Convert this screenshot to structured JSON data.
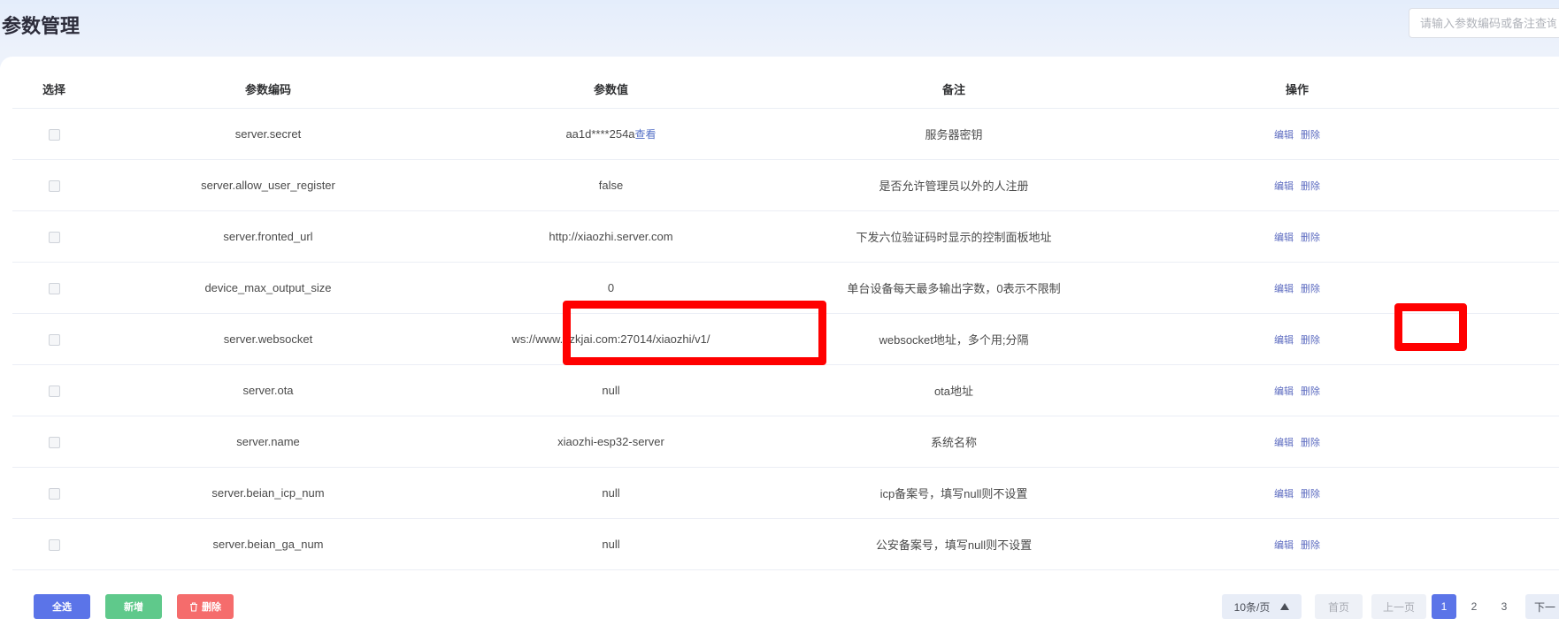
{
  "header": {
    "title": "参数管理",
    "search_placeholder": "请输入参数编码或备注查询"
  },
  "table": {
    "columns": [
      "选择",
      "参数编码",
      "参数值",
      "备注",
      "操作"
    ],
    "rows": [
      {
        "code": "server.secret",
        "value": "aa1d****254a",
        "value_link": "查看",
        "note": "服务器密钥"
      },
      {
        "code": "server.allow_user_register",
        "value": "false",
        "note": "是否允许管理员以外的人注册"
      },
      {
        "code": "server.fronted_url",
        "value": "http://xiaozhi.server.com",
        "note": "下发六位验证码时显示的控制面板地址"
      },
      {
        "code": "device_max_output_size",
        "value": "0",
        "note": "单台设备每天最多输出字数，0表示不限制"
      },
      {
        "code": "server.websocket",
        "value": "ws://www.hzkjai.com:27014/xiaozhi/v1/",
        "note": "websocket地址，多个用;分隔"
      },
      {
        "code": "server.ota",
        "value": "null",
        "note": "ota地址"
      },
      {
        "code": "server.name",
        "value": "xiaozhi-esp32-server",
        "note": "系统名称"
      },
      {
        "code": "server.beian_icp_num",
        "value": "null",
        "note": "icp备案号，填写null则不设置"
      },
      {
        "code": "server.beian_ga_num",
        "value": "null",
        "note": "公安备案号，填写null则不设置"
      }
    ],
    "actions": {
      "edit": "编辑",
      "delete": "删除"
    }
  },
  "footer": {
    "select_all": "全选",
    "add": "新增",
    "delete": "删除",
    "page_size": "10条/页",
    "first": "首页",
    "prev": "上一页",
    "pages": [
      "1",
      "2",
      "3"
    ],
    "next": "下一"
  },
  "colors": {
    "select_all_btn": "#5b74e8",
    "add_btn": "#5fc98b",
    "delete_btn": "#f56c6c",
    "highlight": "#ff0000"
  }
}
